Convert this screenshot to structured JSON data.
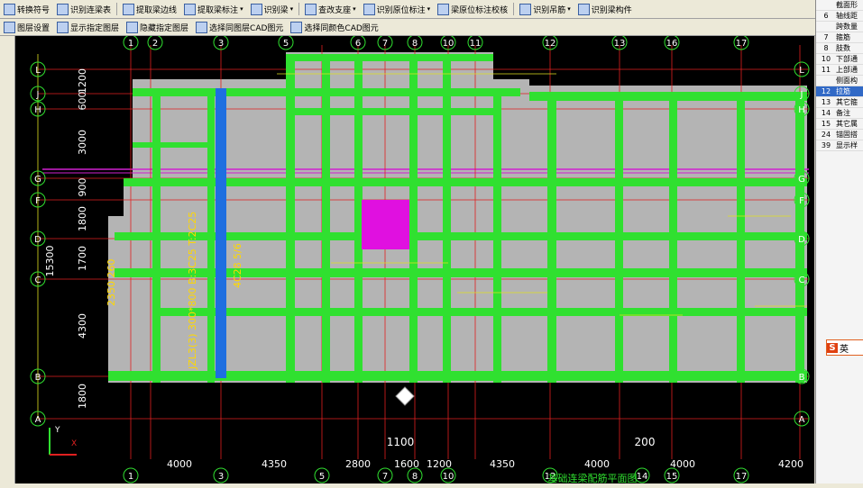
{
  "toolbar_top": [
    {
      "label": "转换符号",
      "dd": false
    },
    {
      "label": "识别连梁表",
      "dd": false
    },
    {
      "label": "提取梁边线",
      "dd": false
    },
    {
      "label": "提取梁标注",
      "dd": true
    },
    {
      "label": "识别梁",
      "dd": true
    },
    {
      "label": "查改支座",
      "dd": true
    },
    {
      "label": "识别原位标注",
      "dd": true
    },
    {
      "label": "梁原位标注校核",
      "dd": false
    },
    {
      "label": "识别吊筋",
      "dd": true
    },
    {
      "label": "识别梁构件",
      "dd": false
    }
  ],
  "toolbar_second": [
    {
      "label": "图层设置"
    },
    {
      "label": "显示指定图层"
    },
    {
      "label": "隐藏指定图层"
    },
    {
      "label": "选择同图层CAD图元"
    },
    {
      "label": "选择同颜色CAD图元"
    }
  ],
  "right_panel": [
    {
      "n": "",
      "t": "截面形"
    },
    {
      "n": "6",
      "t": "轴线距"
    },
    {
      "n": "",
      "t": "跨数量"
    },
    {
      "n": "7",
      "t": "箍筋"
    },
    {
      "n": "8",
      "t": "肢数"
    },
    {
      "n": "10",
      "t": "下部通"
    },
    {
      "n": "11",
      "t": "上部通"
    },
    {
      "n": "",
      "t": "侧面构"
    },
    {
      "n": "12",
      "t": "拉筋",
      "sel": true
    },
    {
      "n": "13",
      "t": "其它箍"
    },
    {
      "n": "14",
      "t": "备注"
    },
    {
      "n": "15",
      "t": "其它属"
    },
    {
      "n": "24",
      "t": "锚固搭"
    },
    {
      "n": "39",
      "t": "显示样"
    }
  ],
  "ime": {
    "text": "英"
  },
  "drawing": {
    "top_axis": [
      "1",
      "2",
      "3",
      "5",
      "6",
      "7",
      "8",
      "10",
      "11",
      "12",
      "13",
      "16",
      "17"
    ],
    "bottom_axis": [
      "1",
      "3",
      "5",
      "7",
      "8",
      "10",
      "12",
      "14",
      "15",
      "17"
    ],
    "left_axis": [
      "L",
      "J",
      "H",
      "G",
      "F",
      "D",
      "C",
      "B",
      "A"
    ],
    "right_axis": [
      "L",
      "J",
      "H",
      "G",
      "F",
      "D",
      "C",
      "B",
      "A"
    ],
    "left_dims": [
      "1200",
      "600",
      "3000",
      "900",
      "1800",
      "1700",
      "4300",
      "1800"
    ],
    "left_total": "15300",
    "bottom_dims": [
      "4000",
      "4350",
      "2800",
      "1600",
      "1200",
      "4350",
      "4000",
      "4000",
      "4200"
    ],
    "mid_dims": [
      "1100",
      "200"
    ],
    "beam_text_1": "JZL3(3) 300*800 B:3C25 T:2C25",
    "beam_text_2": "4C28 5/6",
    "beam_text_3": "2350 260",
    "title": "基础连梁配筋平面图"
  }
}
